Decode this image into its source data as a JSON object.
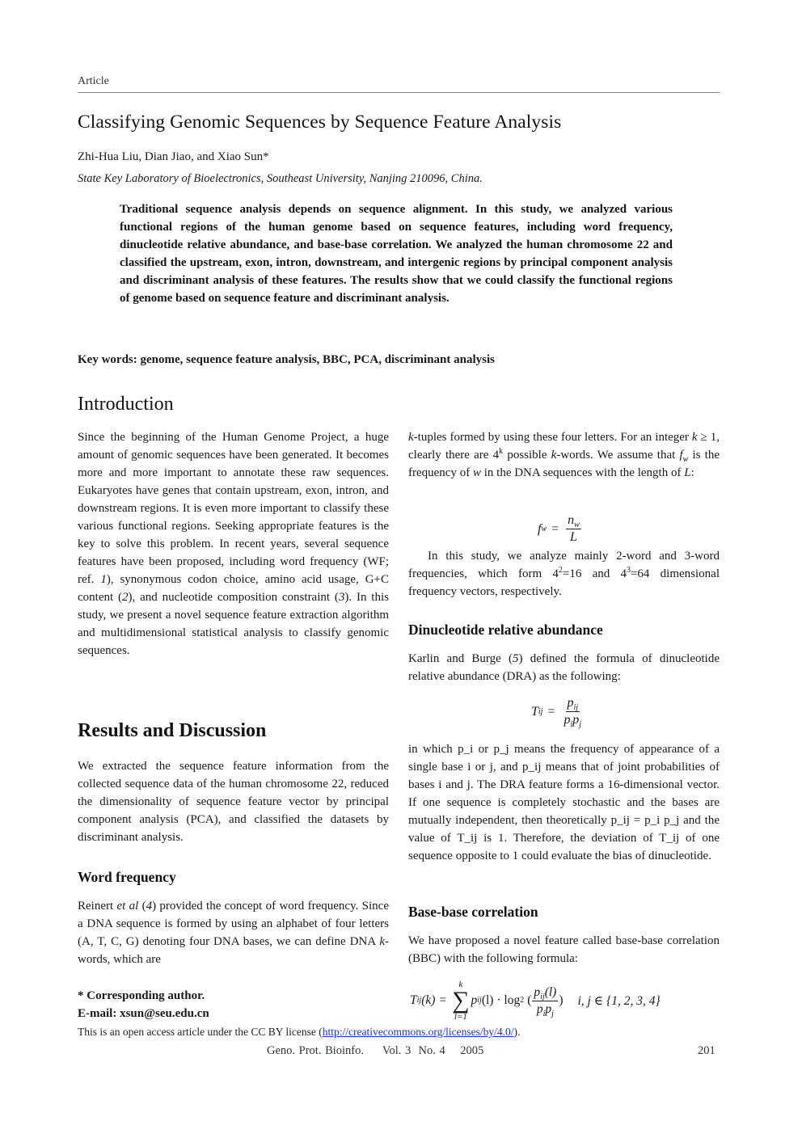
{
  "running_head": "Article",
  "title": "Classifying Genomic Sequences by Sequence Feature Analysis",
  "authors": "Zhi-Hua Liu, Dian Jiao, and Xiao Sun*",
  "affiliation": "State Key Laboratory of Bioelectronics, Southeast University, Nanjing 210096, China.",
  "abstract": "Traditional sequence analysis depends on sequence alignment. In this study, we analyzed various functional regions of the human genome based on sequence features, including word frequency, dinucleotide relative abundance, and base-base correlation. We analyzed the human chromosome 22 and classified the upstream, exon, intron, downstream, and intergenic regions by principal component analysis and discriminant analysis of these features. The results show that we could classify the functional regions of genome based on sequence feature and discriminant analysis.",
  "keywords": "Key words: genome, sequence feature analysis, BBC, PCA, discriminant analysis",
  "sections": {
    "introduction": {
      "heading": "Introduction",
      "paragraph_a": "Since the beginning of the Human Genome Project, a huge amount of genomic sequences have been generated. It becomes more and more important to annotate these raw sequences. Eukaryotes have genes that contain upstream, exon, intron, and downstream regions. It is even more important to classify these various functional regions. Seeking appropriate features is the key to solve this problem. In recent years, several sequence features have been proposed, including word frequency (WF; ref. ",
      "ref1": "1",
      "paragraph_b": "), synonymous codon choice, amino acid usage, G+C content (",
      "ref2": "2",
      "paragraph_c": "), and nucleotide composition constraint (",
      "ref3": "3",
      "paragraph_d": "). In this study, we present a novel sequence feature extraction algorithm and multidimensional statistical analysis to classify genomic sequences."
    },
    "results": {
      "heading": "Results and Discussion",
      "paragraph": "We extracted the sequence feature information from the collected sequence data of the human chromosome 22, reduced the dimensionality of sequence feature vector by principal component analysis (PCA), and classified the datasets by discriminant analysis."
    },
    "word_frequency": {
      "heading": "Word frequency",
      "p1_a": "Reinert ",
      "p1_etal": "et al",
      "p1_b": " (",
      "ref4": "4",
      "p1_c": ") provided the concept of word frequency. Since a DNA sequence is formed by using an alphabet of four letters (A, T, C, G) denoting four DNA bases, we can define DNA ",
      "p1_k": "k",
      "p1_d": "-words, which are ",
      "p1_k2": "k",
      "p1_e": "-tuples formed by using these four letters. For an integer ",
      "p1_k3": "k",
      "p1_f": " ≥ 1, clearly there are 4",
      "p1_sup": "k",
      "p1_g": " possible ",
      "p1_k4": "k",
      "p1_h": "-words. We assume that ",
      "p1_fw": "f",
      "p1_w_sub": "w",
      "p1_i": " is the frequency of ",
      "p1_w": "w",
      "p1_j": " in the DNA sequences with the length of ",
      "p1_L": "L",
      "p1_k_end": ":",
      "eq_lhs_f": "f",
      "eq_lhs_sub": "w",
      "eq_equals": "=",
      "eq_num_n": "n",
      "eq_num_sub": "w",
      "eq_den": "L",
      "p2_a": "In this study, we analyze mainly 2-word and 3-word frequencies, which form 4",
      "p2_sup1": "2",
      "p2_b": "=16 and 4",
      "p2_sup2": "3",
      "p2_c": "=64 dimensional frequency vectors, respectively."
    },
    "dinucleotide": {
      "heading": "Dinucleotide relative abundance",
      "p1_a": "Karlin and Burge (",
      "ref5": "5",
      "p1_b": ") defined the formula of dinucleotide relative abundance (DRA) as the following:",
      "eq_lhs": "T",
      "eq_lhs_sub": "ij",
      "eq_equals": "=",
      "eq_num": "p",
      "eq_num_sub": "ij",
      "eq_den_1": "p",
      "eq_den_1_sub": "i",
      "eq_den_2": "p",
      "eq_den_2_sub": "j",
      "p2": "in which p_i or p_j means the frequency of appearance of a single base i or j, and p_ij means that of joint probabilities of bases i and j. The DRA feature forms a 16-dimensional vector. If one sequence is completely stochastic and the bases are mutually independent, then theoretically p_ij = p_i p_j and the value of T_ij is 1. Therefore, the deviation of T_ij of one sequence opposite to 1 could evaluate the bias of dinucleotide."
    },
    "bbc": {
      "heading": "Base-base correlation",
      "p1": "We have proposed a novel feature called base-base correlation (BBC) with the following formula:",
      "eq_lhs": "T",
      "eq_lhs_sub": "ij",
      "eq_lhs_arg": "(k)",
      "eq_equals": "=",
      "sum_upper": "k",
      "sum_lower": "l=1",
      "sum_symbol": "∑",
      "term_p": "p",
      "term_sub": "ij",
      "term_arg": "(l) · log",
      "log_base": "2",
      "paren_open": "(",
      "frac_num_p": "p",
      "frac_num_sub": "ij",
      "frac_num_arg": "(l)",
      "frac_den_1": "p",
      "frac_den_1_sub": "i",
      "frac_den_2": "p",
      "frac_den_2_sub": "j",
      "paren_close": ")",
      "domain": "i, j ∈ {1, 2, 3, 4}"
    }
  },
  "footnote": {
    "corresponding": "* Corresponding author.",
    "email_label": "E-mail: ",
    "email": "xsun@seu.edu.cn"
  },
  "license": {
    "text_before": "This is an open access article under the CC BY license (",
    "link": "http://creativecommons.org/licenses/by/4.0/",
    "text_after": ")."
  },
  "footer": {
    "journal": "Geno. Prot. Bioinfo.",
    "volume": "Vol. 3",
    "number": "No. 4",
    "year": "2005",
    "page": "201"
  },
  "colors": {
    "link": "#1a33cc",
    "rule": "#888888"
  }
}
